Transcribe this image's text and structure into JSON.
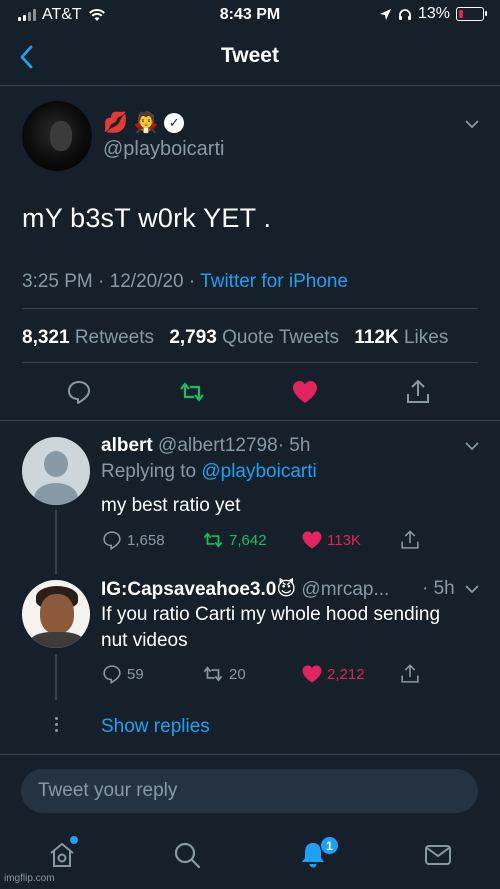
{
  "status_bar": {
    "carrier": "AT&T",
    "time": "8:43 PM",
    "battery": "13%"
  },
  "nav": {
    "title": "Tweet"
  },
  "tweet": {
    "emojis": "💋 🧛",
    "verified_mark": "✓",
    "handle": "@playboicarti",
    "text": "mY b3sT w0rk YET .",
    "time": "3:25 PM",
    "date": "12/20/20",
    "source": "Twitter for iPhone",
    "meta_sep": "·",
    "retweets_count": "8,321",
    "retweets_label": "Retweets",
    "quotes_count": "2,793",
    "quotes_label": "Quote Tweets",
    "likes_count": "112K",
    "likes_label": "Likes"
  },
  "replies": [
    {
      "name": "albert",
      "handle": "@albert12798",
      "age": "· 5h",
      "replying_prefix": "Replying to ",
      "replying_to": "@playboicarti",
      "text": "my best ratio yet",
      "replies": "1,658",
      "retweets": "7,642",
      "likes": "113K"
    },
    {
      "name": "IG:Capsaveahoe3.0",
      "name_emoji": "😈",
      "handle": "@mrcap...",
      "age": "· 5h",
      "text_line1": "If you ratio Carti my whole hood sending",
      "text_line2": "nut videos",
      "replies": "59",
      "retweets": "20",
      "likes": "2,212"
    }
  ],
  "show_replies": "Show replies",
  "reply_box": {
    "placeholder": "Tweet your reply"
  },
  "tabbar": {
    "notifications_badge": "1"
  },
  "watermark": "imgflip.com",
  "colors": {
    "background": "#15202b",
    "accent": "#1da1f2",
    "retweet_green": "#17bf63",
    "like_red": "#e0245e",
    "muted": "#8899a6"
  }
}
